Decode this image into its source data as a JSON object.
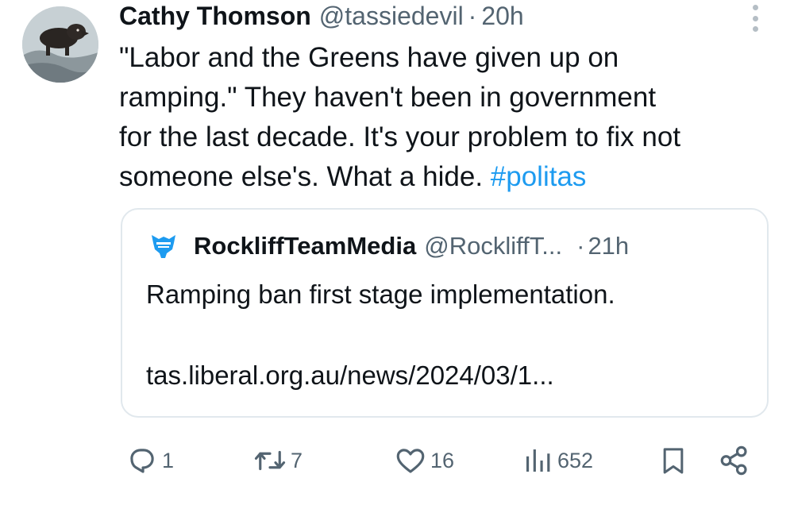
{
  "tweet": {
    "author_name": "Cathy Thomson",
    "author_handle": "@tassiedevil",
    "separator": "·",
    "time": "20h",
    "text_lines": [
      "\"Labor and the Greens have given up on",
      "ramping.\" They haven't been in government",
      "for the last decade. It's your problem to fix not",
      "someone else's. What a hide. "
    ],
    "hashtag": "#politas"
  },
  "quote": {
    "author_name": "RockliffTeamMedia",
    "author_handle": "@RockliffT...",
    "separator": "·",
    "time": "21h",
    "text": "Ramping ban first stage implementation.",
    "link": "tas.liberal.org.au/news/2024/03/1..."
  },
  "actions": {
    "replies": "1",
    "retweets": "7",
    "likes": "16",
    "views": "652"
  },
  "colors": {
    "text": "#0f1419",
    "secondary": "#536471",
    "link": "#1d9bf0",
    "border": "#e1e8ed",
    "quote_logo": "#1d9bf0"
  },
  "icons": {
    "more": "more-vertical-icon",
    "reply": "reply-bubble-icon",
    "retweet": "retweet-icon",
    "like": "heart-icon",
    "views": "views-bar-chart-icon",
    "bookmark": "bookmark-icon",
    "share": "share-icon"
  }
}
